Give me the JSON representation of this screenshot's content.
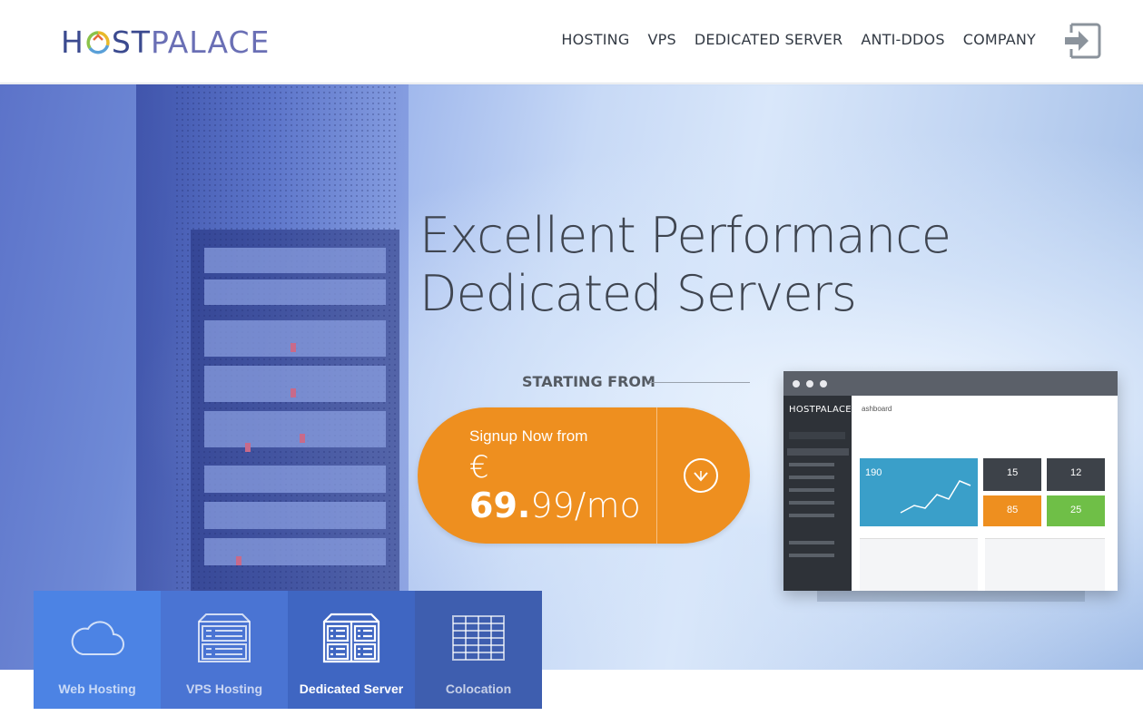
{
  "brand": {
    "logo_text_host": "H",
    "logo_text_st": "ST",
    "logo_text_palace": "PALACE"
  },
  "nav": {
    "items": [
      {
        "label": "HOSTING"
      },
      {
        "label": "VPS"
      },
      {
        "label": "DEDICATED SERVER"
      },
      {
        "label": "ANTI-DDOS"
      },
      {
        "label": "COMPANY"
      }
    ]
  },
  "hero": {
    "title_line1": "Excellent Performance",
    "title_line2": "Dedicated Servers",
    "starting_from": "STARTING FROM",
    "cta": {
      "signup_text": "Signup Now from",
      "currency": "€",
      "price_bold": "69.",
      "price_rest": "99/mo"
    }
  },
  "dashboard_preview": {
    "logo_host": "H",
    "logo_st": "ST",
    "logo_palace": "PALACE",
    "title": "ashboard",
    "tiles": [
      {
        "value": "190"
      },
      {
        "value": "15"
      },
      {
        "value": "12"
      },
      {
        "value": "85"
      },
      {
        "value": "25"
      }
    ]
  },
  "service_tabs": [
    {
      "label": "Web Hosting",
      "icon": "cloud-icon"
    },
    {
      "label": "VPS Hosting",
      "icon": "vps-server-icon"
    },
    {
      "label": "Dedicated Server",
      "icon": "dedicated-server-icon",
      "active": true
    },
    {
      "label": "Colocation",
      "icon": "colocation-rack-icon"
    }
  ],
  "colors": {
    "cta_orange": "#ee8f1f",
    "logo_navy": "#3b4a8f",
    "logo_violet": "#6a6fb5"
  }
}
